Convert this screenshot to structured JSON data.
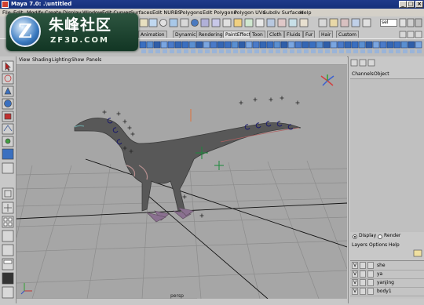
{
  "window": {
    "title": "Maya 7.0: .\\untitled"
  },
  "menu": [
    "File",
    "Edit",
    "Modify",
    "Create",
    "Display",
    "Window",
    "Edit Curves",
    "Surfaces",
    "Edit NURBS",
    "Polygons",
    "Edit Polygons",
    "Polygon UVs",
    "Subdiv Surfaces",
    "Help"
  ],
  "toolbar": {
    "field_value": "sel"
  },
  "shelf_tabs": [
    "Animation",
    "Dynamics",
    "Rendering",
    "PaintEffects",
    "Toon",
    "Cloth",
    "Fluids",
    "Fur",
    "Hair",
    "Custom"
  ],
  "logo": {
    "cn": "朱峰社区",
    "en": "ZF3D.COM"
  },
  "viewport": {
    "menu": [
      "View",
      "Shading",
      "Lighting",
      "Show",
      "Panels"
    ],
    "camera_label": "persp"
  },
  "channel_box": {
    "tabs": [
      "Channels",
      "Object"
    ]
  },
  "layer_editor": {
    "display_label": "Display",
    "render_label": "Render",
    "menu": [
      "Layers",
      "Options",
      "Help"
    ],
    "layers": [
      {
        "vis": "V",
        "name": "she"
      },
      {
        "vis": "V",
        "name": "ya"
      },
      {
        "vis": "V",
        "name": "yanjing"
      },
      {
        "vis": "V",
        "name": "body1"
      }
    ]
  },
  "colors": {
    "title_bar": "#1f3a8a",
    "viewport_bg": "#a6a6a6",
    "logo_bg": "#2d5540"
  }
}
